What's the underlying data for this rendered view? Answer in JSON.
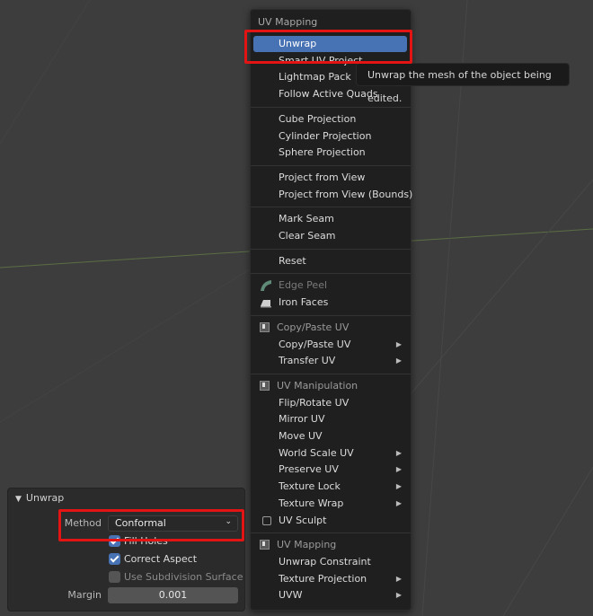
{
  "menu": {
    "title": "UV Mapping",
    "tooltip": "Unwrap the mesh of the object being edited.",
    "groups": [
      [
        {
          "label": "Unwrap",
          "active": true
        },
        {
          "label": "Smart UV Project"
        },
        {
          "label": "Lightmap Pack"
        },
        {
          "label": "Follow Active Quads"
        }
      ],
      [
        {
          "label": "Cube Projection"
        },
        {
          "label": "Cylinder Projection"
        },
        {
          "label": "Sphere Projection"
        }
      ],
      [
        {
          "label": "Project from View"
        },
        {
          "label": "Project from View (Bounds)"
        }
      ],
      [
        {
          "label": "Mark Seam"
        },
        {
          "label": "Clear Seam"
        }
      ],
      [
        {
          "label": "Reset"
        }
      ],
      [
        {
          "label": "Edge Peel",
          "disabled": true,
          "icon": "edge-peel-icon"
        },
        {
          "label": "Iron Faces",
          "icon": "iron-icon"
        }
      ],
      [
        {
          "header": "Copy/Paste UV"
        },
        {
          "label": "Copy/Paste UV",
          "submenu": true
        },
        {
          "label": "Transfer UV",
          "submenu": true
        }
      ],
      [
        {
          "header": "UV Manipulation"
        },
        {
          "label": "Flip/Rotate UV"
        },
        {
          "label": "Mirror UV"
        },
        {
          "label": "Move UV"
        },
        {
          "label": "World Scale UV",
          "submenu": true
        },
        {
          "label": "Preserve UV",
          "submenu": true
        },
        {
          "label": "Texture Lock",
          "submenu": true
        },
        {
          "label": "Texture Wrap",
          "submenu": true
        },
        {
          "label": "UV Sculpt",
          "checkbox": true
        }
      ],
      [
        {
          "header": "UV Mapping"
        },
        {
          "label": "Unwrap Constraint"
        },
        {
          "label": "Texture Projection",
          "submenu": true
        },
        {
          "label": "UVW",
          "submenu": true
        }
      ]
    ]
  },
  "panel": {
    "title": "Unwrap",
    "method_label": "Method",
    "method_value": "Conformal",
    "fill_holes": "Fill Holes",
    "correct_aspect": "Correct Aspect",
    "use_subdivision": "Use Subdivision Surface",
    "margin_label": "Margin",
    "margin_value": "0.001"
  },
  "colors": {
    "highlight": "#e31414",
    "active": "#4772b3"
  }
}
